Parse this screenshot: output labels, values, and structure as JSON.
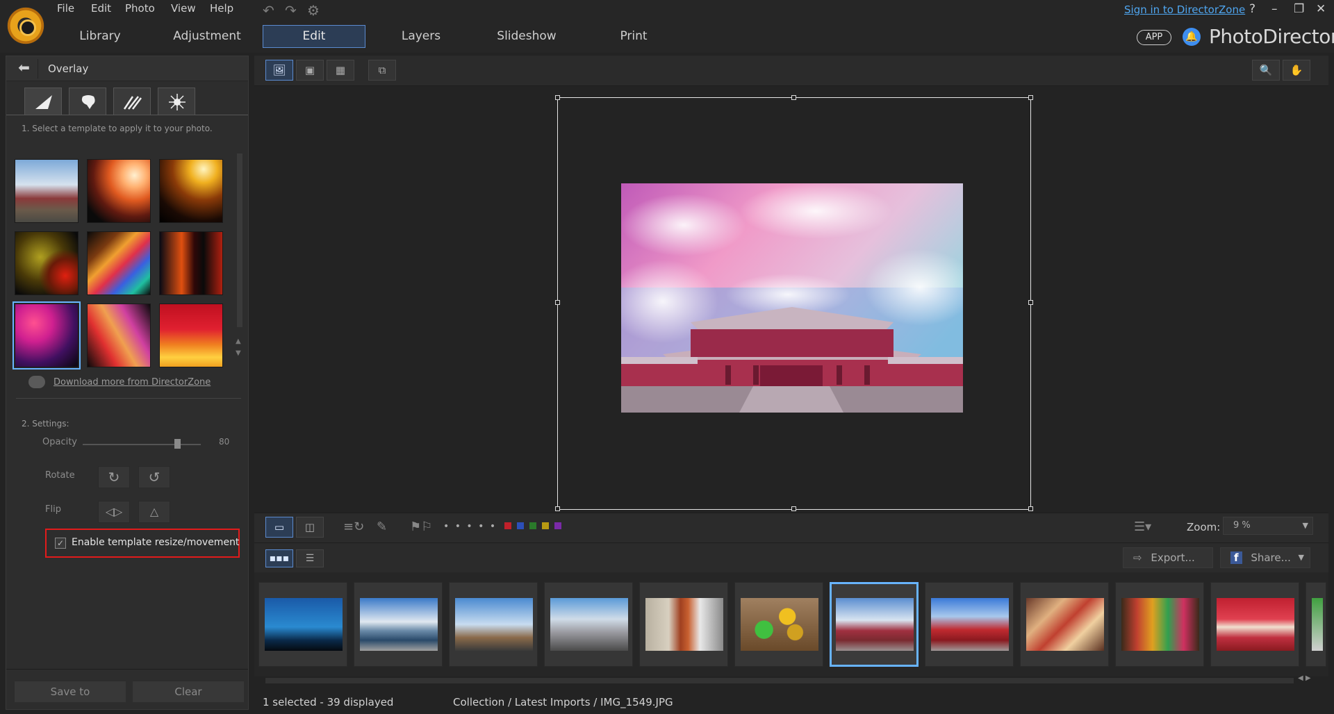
{
  "menu": {
    "items": [
      "File",
      "Edit",
      "Photo",
      "View",
      "Help"
    ],
    "undo_icon": "undo-icon",
    "redo_icon": "redo-icon",
    "settings_icon": "gear-icon"
  },
  "modes": {
    "tabs": [
      "Library",
      "Adjustment",
      "Edit",
      "Layers",
      "Slideshow",
      "Print"
    ],
    "active": "Edit"
  },
  "account": {
    "signin": "Sign in to DirectorZone",
    "help": "?",
    "app_badge": "APP",
    "brand": "PhotoDirector"
  },
  "colors": {
    "accent": "#5b8bd0",
    "selection": "#68b4ff",
    "highlight_box": "#e21b1b",
    "link": "#4fa6f0"
  },
  "panel": {
    "title": "Overlay",
    "category_tabs": [
      "light-leak-icon",
      "splash-icon",
      "streak-icon",
      "bokeh-burst-icon"
    ],
    "step1": "1. Select a template to apply it to your photo.",
    "download_link": "Download more from DirectorZone",
    "step2": "2. Settings:",
    "opacity_label": "Opacity",
    "opacity_value": "80",
    "rotate_label": "Rotate",
    "flip_label": "Flip",
    "enable_label": "Enable template resize/movement",
    "enable_checked": true,
    "save_button": "Save to",
    "clear_button": "Clear",
    "selected_template_index": 6
  },
  "bottombar": {
    "zoom_label": "Zoom:",
    "zoom_value": "9 %",
    "rating_dots": "• • • • •",
    "color_labels": [
      "#c0202a",
      "#2c4fb8",
      "#2a7a2a",
      "#b89a12",
      "#7a2aa8"
    ]
  },
  "strip": {
    "export_label": "Export...",
    "share_label": "Share...",
    "selected_index": 6,
    "photo_count": 11
  },
  "status": {
    "selection": "1 selected - 39 displayed",
    "path": "Collection / Latest Imports / IMG_1549.JPG"
  }
}
